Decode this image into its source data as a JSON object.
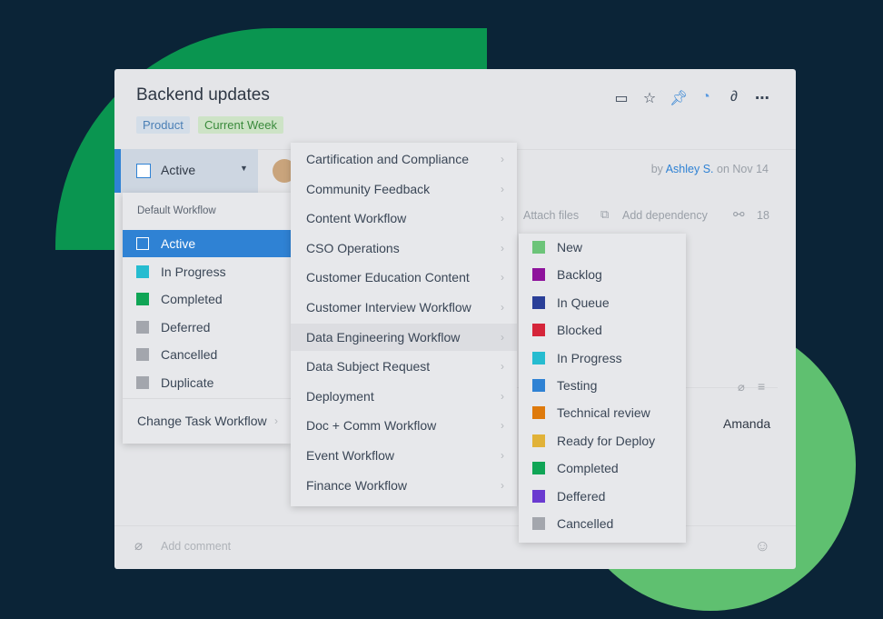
{
  "task": {
    "title": "Backend updates",
    "tags": [
      {
        "label": "Product",
        "bg": "#d3dde8",
        "fg": "#4a7fb5"
      },
      {
        "label": "Current Week",
        "bg": "#cde3c6",
        "fg": "#3a8a3c"
      }
    ],
    "icons": [
      "calendar-icon",
      "star-icon",
      "pin-icon",
      "rss-icon",
      "link-icon",
      "more-icon"
    ],
    "status": "Active",
    "author_prefix": "by",
    "author": "Ashley S.",
    "date_text": "on Nov 14",
    "attach_files": "Attach files",
    "add_dependency": "Add dependency",
    "share_count": "18",
    "assignee": "Amanda",
    "comment_placeholder": "Add comment"
  },
  "status_menu": {
    "header": "Default Workflow",
    "items": [
      {
        "label": "Active",
        "color": "#ffffff",
        "selected": true
      },
      {
        "label": "In Progress",
        "color": "#26bcd0"
      },
      {
        "label": "Completed",
        "color": "#10a556"
      },
      {
        "label": "Deferred",
        "color": "#a3a6ad"
      },
      {
        "label": "Cancelled",
        "color": "#a3a6ad"
      },
      {
        "label": "Duplicate",
        "color": "#a3a6ad"
      }
    ],
    "change_workflow": "Change Task Workflow"
  },
  "workflows": [
    "Cartification and Compliance",
    "Community Feedback",
    "Content Workflow",
    "CSO Operations",
    "Customer Education Content",
    "Customer Interview Workflow",
    "Data Engineering Workflow",
    "Data Subject Request",
    "Deployment",
    "Doc + Comm Workflow",
    "Event Workflow",
    "Finance Workflow"
  ],
  "workflow_statuses": [
    {
      "label": "New",
      "color": "#6cc479"
    },
    {
      "label": "Backlog",
      "color": "#8e139c"
    },
    {
      "label": "In Queue",
      "color": "#2a3f98"
    },
    {
      "label": "Blocked",
      "color": "#d5253a"
    },
    {
      "label": "In Progress",
      "color": "#26bcd0"
    },
    {
      "label": "Testing",
      "color": "#2f82d4"
    },
    {
      "label": "Technical review",
      "color": "#de7a0c"
    },
    {
      "label": "Ready for Deploy",
      "color": "#e1b238"
    },
    {
      "label": "Completed",
      "color": "#10a556"
    },
    {
      "label": "Deffered",
      "color": "#6a3ad0"
    },
    {
      "label": "Cancelled",
      "color": "#a3a6ad"
    }
  ]
}
